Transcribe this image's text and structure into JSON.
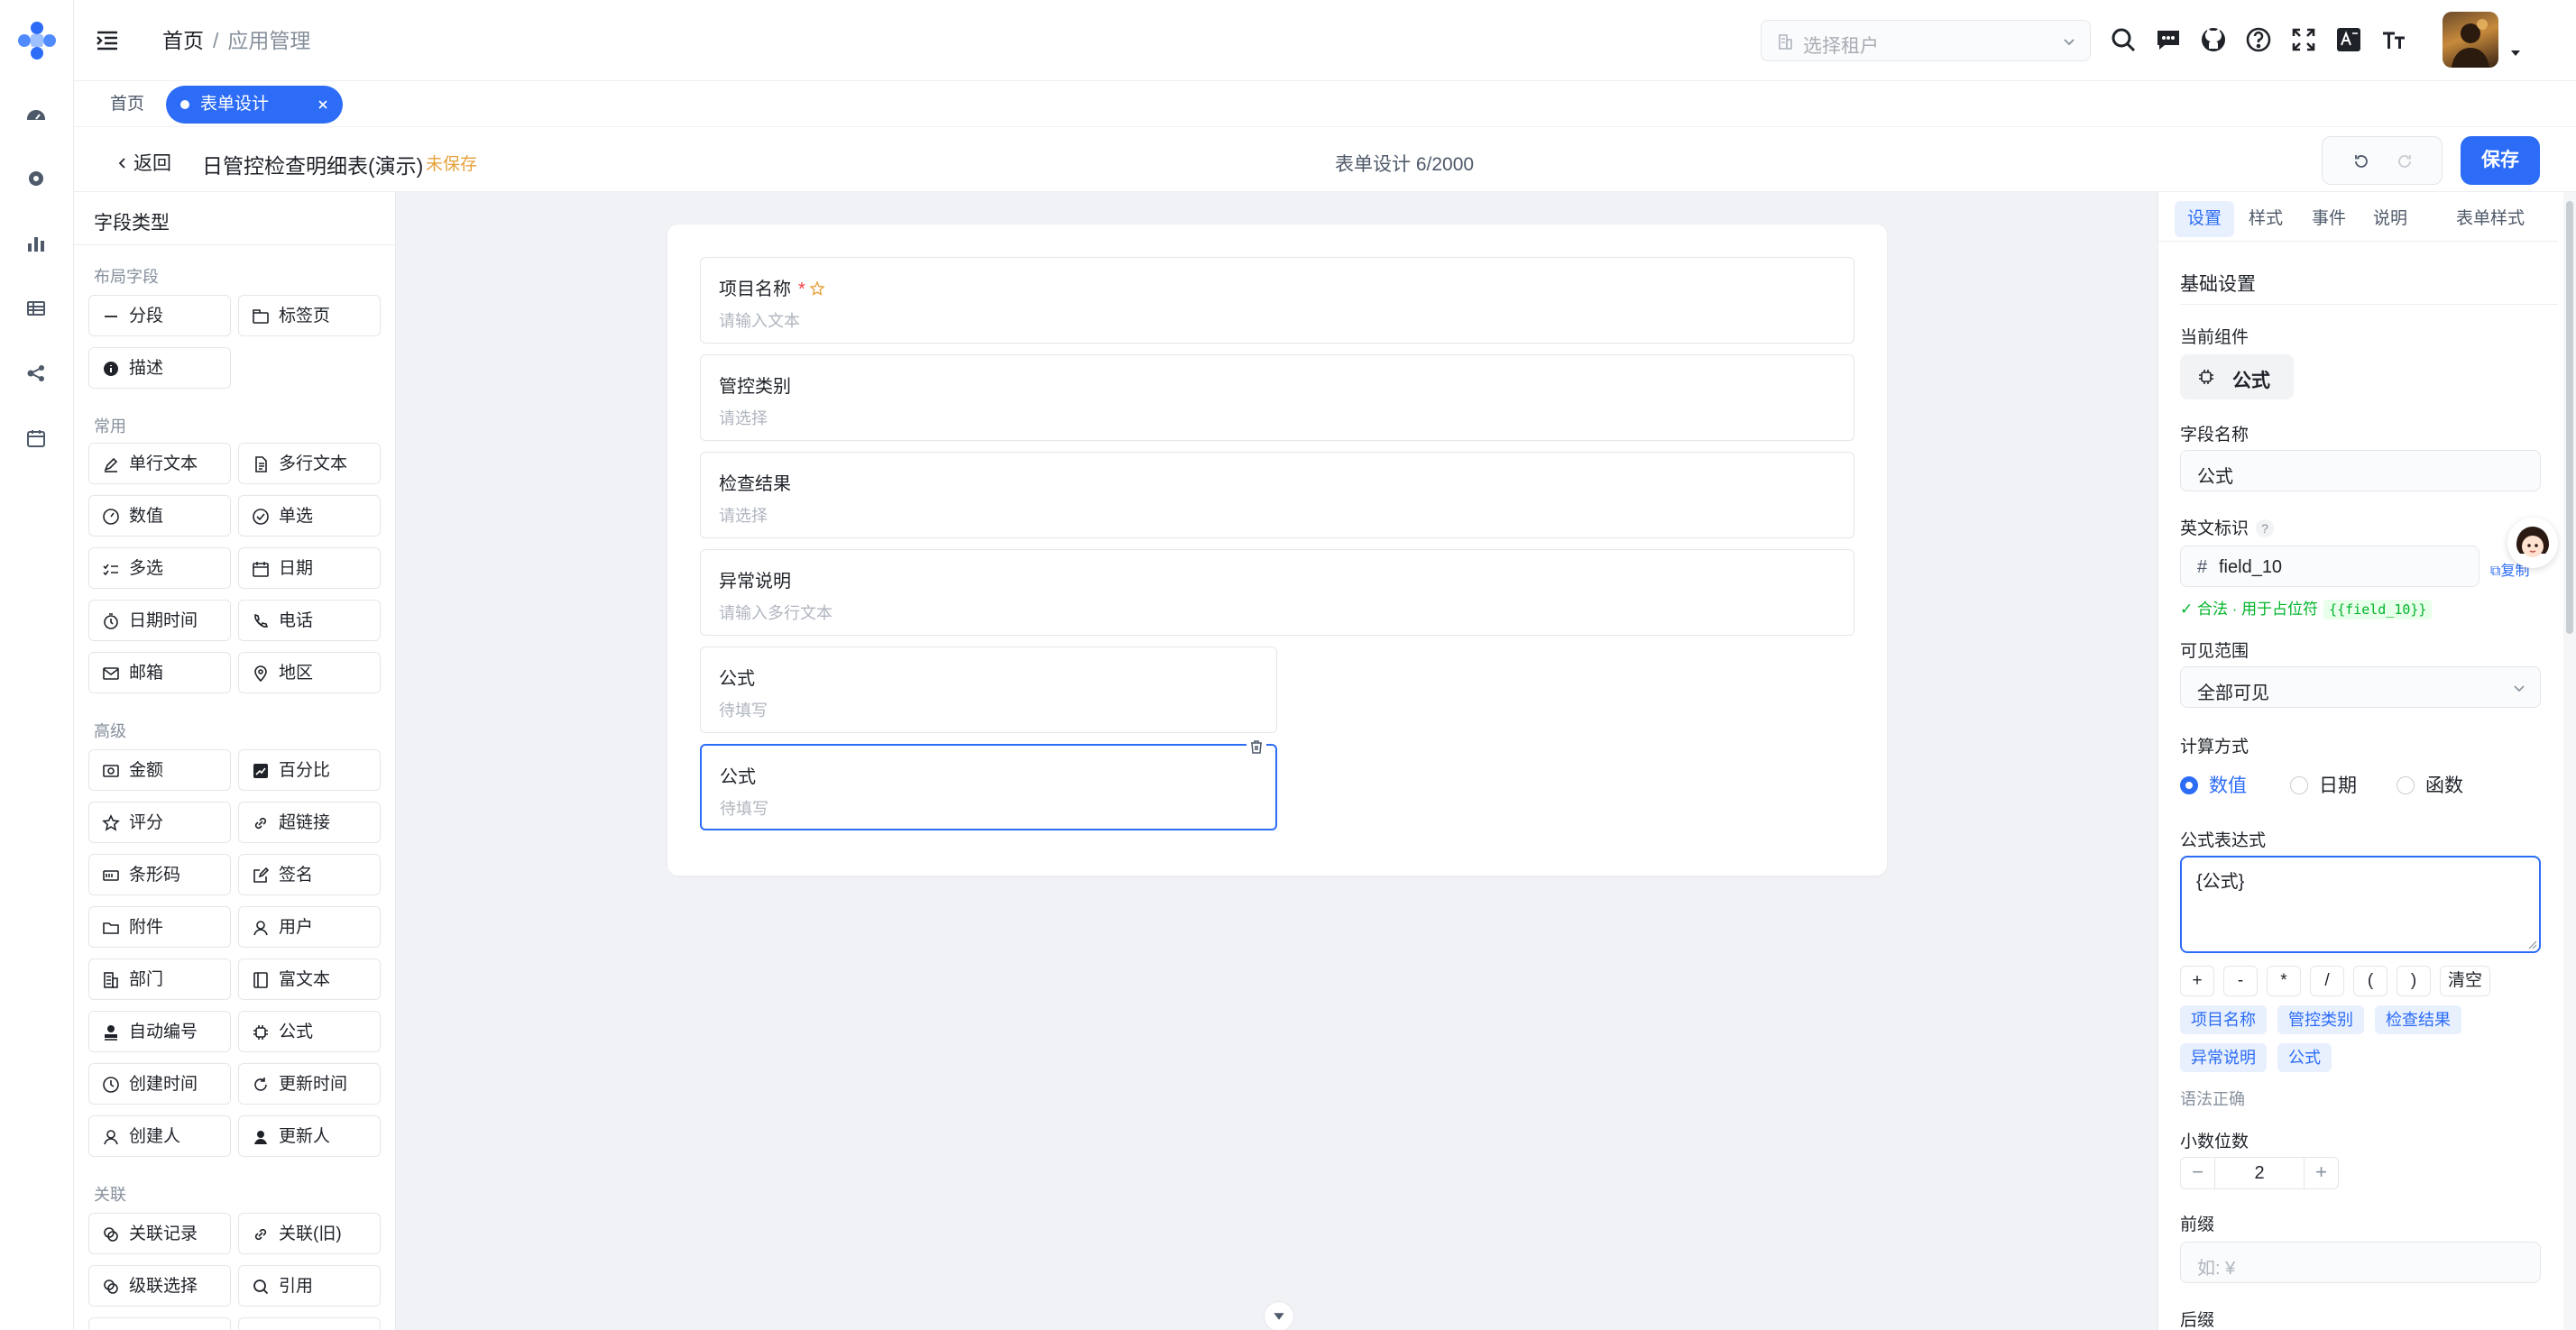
{
  "header": {
    "breadcrumb_home": "首页",
    "breadcrumb_sep": "/",
    "breadcrumb_current": "应用管理",
    "tenant_placeholder": "选择租户"
  },
  "tabs": {
    "home": "首页",
    "active": "表单设计"
  },
  "designer": {
    "back_label": "返回",
    "form_title": "日管控检查明细表(演示)",
    "unsaved": "未保存",
    "counter": "表单设计 6/2000",
    "save_label": "保存"
  },
  "palette": {
    "title": "字段类型",
    "groups": {
      "layout": "布局字段",
      "common": "常用",
      "advanced": "高级",
      "relation": "关联"
    },
    "items": {
      "section": "分段",
      "tabpage": "标签页",
      "description": "描述",
      "single_text": "单行文本",
      "multi_text": "多行文本",
      "number": "数值",
      "radio": "单选",
      "checkbox": "多选",
      "date": "日期",
      "datetime": "日期时间",
      "phone": "电话",
      "email": "邮箱",
      "region": "地区",
      "amount": "金额",
      "percent": "百分比",
      "rating": "评分",
      "hyperlink": "超链接",
      "barcode": "条形码",
      "signature": "签名",
      "attachment": "附件",
      "user": "用户",
      "department": "部门",
      "richtext": "富文本",
      "autonumber": "自动编号",
      "formula": "公式",
      "created_time": "创建时间",
      "updated_time": "更新时间",
      "creator": "创建人",
      "updater": "更新人",
      "relation_record": "关联记录",
      "relation_old": "关联(旧)",
      "cascade": "级联选择",
      "reference": "引用"
    }
  },
  "canvas": {
    "fields": [
      {
        "label": "项目名称",
        "required": "*",
        "placeholder": "请输入文本"
      },
      {
        "label": "管控类别",
        "placeholder": "请选择"
      },
      {
        "label": "检查结果",
        "placeholder": "请选择"
      },
      {
        "label": "异常说明",
        "placeholder": "请输入多行文本"
      },
      {
        "label": "公式",
        "placeholder": "待填写"
      },
      {
        "label": "公式",
        "placeholder": "待填写"
      }
    ]
  },
  "panel": {
    "tabs": [
      "设置",
      "样式",
      "事件",
      "说明"
    ],
    "form_style": "表单样式",
    "basic_settings": "基础设置",
    "current_component_label": "当前组件",
    "current_component": "公式",
    "field_name_label": "字段名称",
    "field_name": "公式",
    "english_id_label": "英文标识",
    "help": "?",
    "english_id_prefix": "#",
    "english_id": "field_10",
    "copy": "复制",
    "valid_text": "✓ 合法 · 用于占位符",
    "valid_code": "{{field_10}}",
    "visibility_label": "可见范围",
    "visibility": "全部可见",
    "calc_label": "计算方式",
    "calc_options": [
      "数值",
      "日期",
      "函数"
    ],
    "calc_selected": "数值",
    "expr_label": "公式表达式",
    "expr": "{公式}",
    "ops": [
      "+",
      "-",
      "*",
      "/",
      "(",
      ")",
      "清空"
    ],
    "field_tags": [
      "项目名称",
      "管控类别",
      "检查结果",
      "异常说明",
      "公式"
    ],
    "syntax_status": "语法正确",
    "decimals_label": "小数位数",
    "decimals": "2",
    "minus": "−",
    "plus": "+",
    "prefix_label": "前缀",
    "prefix_placeholder": "如: ¥",
    "suffix_label": "后缀"
  },
  "colors": {
    "primary": "#2c6cf6",
    "warning": "#e6a23c",
    "success": "#00b42a",
    "required": "#f53f3f"
  }
}
